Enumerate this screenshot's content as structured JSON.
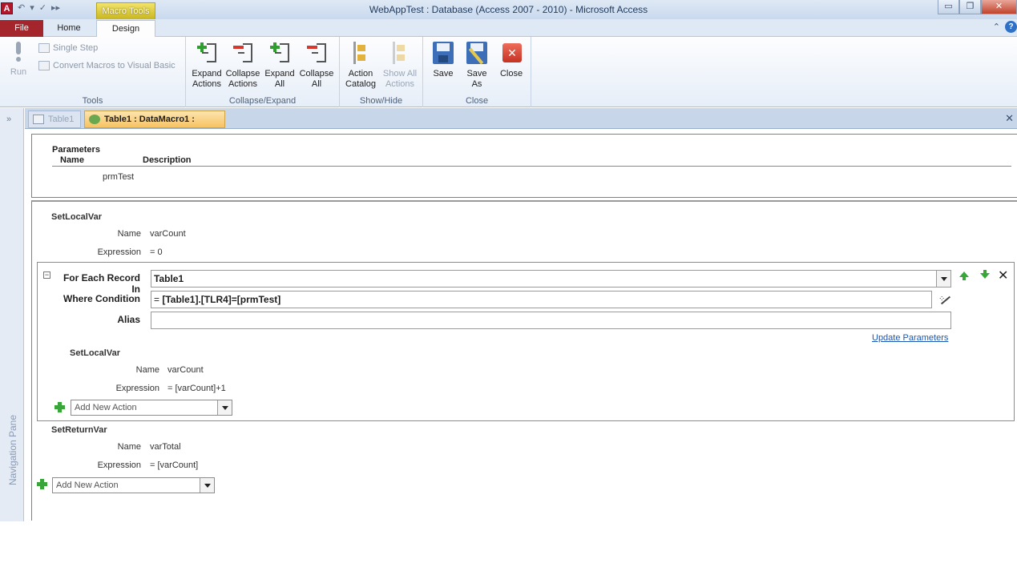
{
  "window": {
    "title": "WebAppTest : Database (Access 2007 - 2010)  -  Microsoft Access",
    "app_icon": "A",
    "context_tab_group": "Macro Tools",
    "minimize_glyph": "▭",
    "restore_glyph": "❐",
    "close_glyph": "✕"
  },
  "qat": {
    "undo_glyph": "↶",
    "dropdown_glyph": "▾",
    "redo_glyph": "✓",
    "more_glyph": "▸▸"
  },
  "tabs": {
    "file": "File",
    "home": "Home",
    "design": "Design",
    "collapse_glyph": "⌃",
    "help_glyph": "?"
  },
  "ribbon": {
    "tools": {
      "label": "Tools",
      "run": "Run",
      "single_step": "Single Step",
      "convert": "Convert Macros to Visual Basic"
    },
    "collapse_expand": {
      "label": "Collapse/Expand",
      "expand_actions": "Expand Actions",
      "collapse_actions": "Collapse Actions",
      "expand_all": "Expand All",
      "collapse_all": "Collapse All"
    },
    "show_hide": {
      "label": "Show/Hide",
      "action_catalog": "Action Catalog",
      "show_all_actions": "Show All Actions"
    },
    "close": {
      "label": "Close",
      "save": "Save",
      "save_as": "Save As",
      "close": "Close"
    }
  },
  "nav": {
    "label": "Navigation Pane",
    "chevron": "»"
  },
  "doc_tabs": {
    "tab1": "Table1",
    "tab2": "Table1 : DataMacro1 :",
    "close_glyph": "✕"
  },
  "parameters": {
    "header": "Parameters",
    "col_name": "Name",
    "col_description": "Description",
    "rows": [
      {
        "name": "prmTest",
        "description": ""
      }
    ]
  },
  "macro": {
    "set_local_var_1": {
      "title": "SetLocalVar",
      "name_label": "Name",
      "name_value": "varCount",
      "expr_label": "Expression",
      "expr_value": "= 0"
    },
    "for_each": {
      "collapse_glyph": "−",
      "label": "For Each Record In",
      "value": "Table1",
      "where_label": "Where Condition",
      "where_prefix": "=",
      "where_value": "[Table1].[TLR4]=[prmTest]",
      "alias_label": "Alias",
      "alias_value": "",
      "update_parameters": "Update Parameters",
      "delete_glyph": "✕",
      "inner_set_local_var": {
        "title": "SetLocalVar",
        "name_label": "Name",
        "name_value": "varCount",
        "expr_label": "Expression",
        "expr_value": "= [varCount]+1"
      },
      "add_new_action": "Add New Action"
    },
    "set_return_var": {
      "title": "SetReturnVar",
      "name_label": "Name",
      "name_value": "varTotal",
      "expr_label": "Expression",
      "expr_value": "= [varCount]"
    },
    "add_new_action": "Add New Action"
  }
}
